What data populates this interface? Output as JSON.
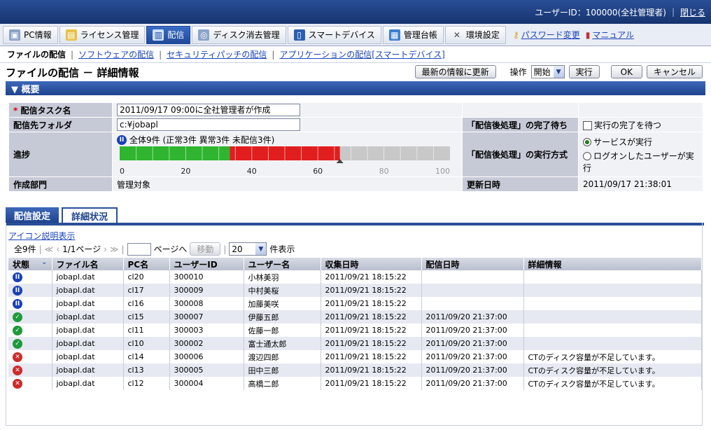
{
  "top": {
    "user_label": "ユーザーID：100000(全社管理者)",
    "close": "閉じる"
  },
  "menu": {
    "tabs": [
      {
        "label": "PC情報",
        "icon": "pc-icon"
      },
      {
        "label": "ライセンス管理",
        "icon": "license-icon"
      },
      {
        "label": "配信",
        "icon": "distribution-icon"
      },
      {
        "label": "ディスク消去管理",
        "icon": "disk-erase-icon"
      },
      {
        "label": "スマートデバイス",
        "icon": "smart-device-icon"
      },
      {
        "label": "管理台帳",
        "icon": "ledger-icon"
      },
      {
        "label": "環境設定",
        "icon": "settings-icon"
      }
    ],
    "password_link": "パスワード変更",
    "manual_link": "マニュアル"
  },
  "subnav": {
    "current": "ファイルの配信",
    "links": [
      "ソフトウェアの配信",
      "セキュリティパッチの配信",
      "アプリケーションの配信[スマートデバイス]"
    ]
  },
  "page": {
    "title": "ファイルの配信 － 詳細情報",
    "refresh": "最新の情報に更新",
    "op_label": "操作",
    "op_value": "開始",
    "execute": "実行",
    "ok": "OK",
    "cancel": "キャンセル"
  },
  "overview": {
    "header": "▼ 概要",
    "task_label": "配信タスク名",
    "task_value": "2011/09/17 09:00に全社管理者が作成",
    "folder_label": "配信先フォルダ",
    "folder_value": "c:¥jobapl",
    "progress_label": "進捗",
    "progress_text": "全体9件 (正常3件 異常3件 未配信3件)",
    "dept_label": "作成部門",
    "dept_value": "管理対象",
    "wait_label": "「配信後処理」の完了待ち",
    "wait_option": "実行の完了を待つ",
    "method_label": "「配信後処理」の実行方式",
    "method_service": "サービスが実行",
    "method_logon": "ログオンしたユーザーが実行",
    "updated_label": "更新日時",
    "updated_value": "2011/09/17 21:38:01"
  },
  "progress": {
    "total": 9,
    "normal": 3,
    "error": 3,
    "undelivered": 3,
    "ticks": [
      "0",
      "20",
      "40",
      "60",
      "80",
      "100"
    ],
    "colors": {
      "normal": "#2fb52f",
      "error": "#e01e1e",
      "pending": "#c8c8c8"
    }
  },
  "tabs": {
    "settings": "配信設定",
    "detail": "詳細状況"
  },
  "icon_desc": "アイコン説明表示",
  "pager": {
    "total": "全9件",
    "pages": "1/1ページ",
    "goto": "ページへ",
    "move": "移動",
    "per_page": "20",
    "show": "件表示"
  },
  "grid": {
    "headers": [
      "状態",
      "ファイル名",
      "PC名",
      "ユーザーID",
      "ユーザー名",
      "収集日時",
      "配信日時",
      "詳細情報"
    ],
    "rows": [
      {
        "status": "pause",
        "file": "jobapl.dat",
        "pc": "cl20",
        "uid": "300010",
        "uname": "小林美羽",
        "collected": "2011/09/21 18:15:22",
        "delivered": "",
        "detail": ""
      },
      {
        "status": "pause",
        "file": "jobapl.dat",
        "pc": "cl17",
        "uid": "300009",
        "uname": "中村美桜",
        "collected": "2011/09/21 18:15:22",
        "delivered": "",
        "detail": ""
      },
      {
        "status": "pause",
        "file": "jobapl.dat",
        "pc": "cl16",
        "uid": "300008",
        "uname": "加藤美咲",
        "collected": "2011/09/21 18:15:22",
        "delivered": "",
        "detail": ""
      },
      {
        "status": "ok",
        "file": "jobapl.dat",
        "pc": "cl15",
        "uid": "300007",
        "uname": "伊藤五郎",
        "collected": "2011/09/21 18:15:22",
        "delivered": "2011/09/20 21:37:00",
        "detail": ""
      },
      {
        "status": "ok",
        "file": "jobapl.dat",
        "pc": "cl11",
        "uid": "300003",
        "uname": "佐藤一郎",
        "collected": "2011/09/21 18:15:22",
        "delivered": "2011/09/20 21:37:00",
        "detail": ""
      },
      {
        "status": "ok",
        "file": "jobapl.dat",
        "pc": "cl10",
        "uid": "300002",
        "uname": "富士通太郎",
        "collected": "2011/09/21 18:15:22",
        "delivered": "2011/09/20 21:37:00",
        "detail": ""
      },
      {
        "status": "err",
        "file": "jobapl.dat",
        "pc": "cl14",
        "uid": "300006",
        "uname": "渡辺四郎",
        "collected": "2011/09/21 18:15:22",
        "delivered": "2011/09/20 21:37:00",
        "detail": "CTのディスク容量が不足しています。"
      },
      {
        "status": "err",
        "file": "jobapl.dat",
        "pc": "cl13",
        "uid": "300005",
        "uname": "田中三郎",
        "collected": "2011/09/21 18:15:22",
        "delivered": "2011/09/20 21:37:00",
        "detail": "CTのディスク容量が不足しています。"
      },
      {
        "status": "err",
        "file": "jobapl.dat",
        "pc": "cl12",
        "uid": "300004",
        "uname": "高橋二郎",
        "collected": "2011/09/21 18:15:22",
        "delivered": "2011/09/20 21:37:00",
        "detail": "CTのディスク容量が不足しています。"
      }
    ]
  }
}
